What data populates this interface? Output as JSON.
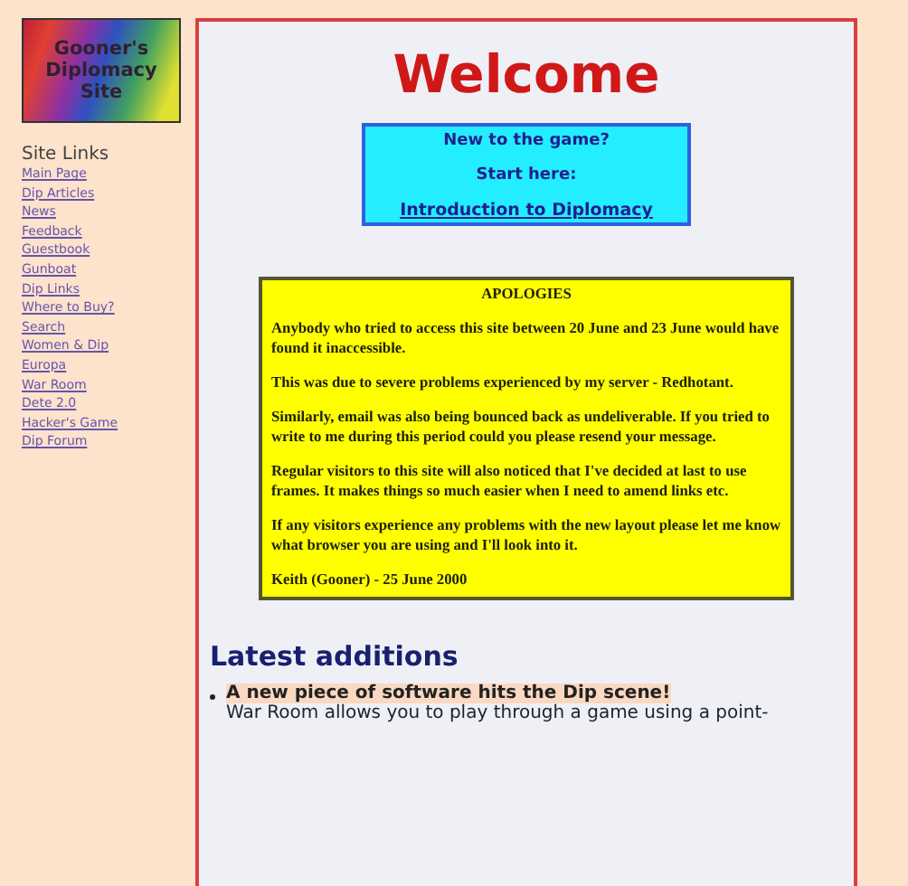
{
  "logo": {
    "text": "Gooner's Diplomacy Site"
  },
  "sidebar": {
    "title": "Site Links",
    "items": [
      {
        "label": "Main Page"
      },
      {
        "label": "Dip Articles"
      },
      {
        "label": "News"
      },
      {
        "label": "Feedback"
      },
      {
        "label": "Guestbook"
      },
      {
        "label": "Gunboat"
      },
      {
        "label": "Dip Links"
      },
      {
        "label": "Where to Buy?"
      },
      {
        "label": "Search"
      },
      {
        "label": "Women & Dip"
      },
      {
        "label": "Europa"
      },
      {
        "label": "War Room"
      },
      {
        "label": "Dete 2.0"
      },
      {
        "label": "Hacker's Game"
      },
      {
        "label": "Dip Forum"
      }
    ]
  },
  "main": {
    "title": "Welcome",
    "intro_box": {
      "line_1": "New to the game?",
      "line_2": "Start here:",
      "link": "Introduction to Diplomacy"
    },
    "notice": {
      "title": "APOLOGIES",
      "paragraphs": [
        "Anybody who tried to access this site between 20 June and 23 June would have found it inaccessible.",
        "This was due to severe problems experienced by my server - Redhotant.",
        "Similarly, email was also being bounced back as undeliverable. If you tried to write to me during this period could you please resend your message.",
        "Regular visitors to this site will also noticed that I've decided at last to use frames. It makes things so much easier when I need to amend links etc.",
        "If any visitors experience any problems with the new layout please let me know what browser you are using and I'll look into it.",
        "Keith (Gooner) - 25 June 2000"
      ]
    },
    "latest": {
      "heading": "Latest additions",
      "items": [
        {
          "title": "A new piece of software hits the Dip scene!",
          "text": "War Room allows you to play through a game using a point-"
        }
      ]
    }
  }
}
